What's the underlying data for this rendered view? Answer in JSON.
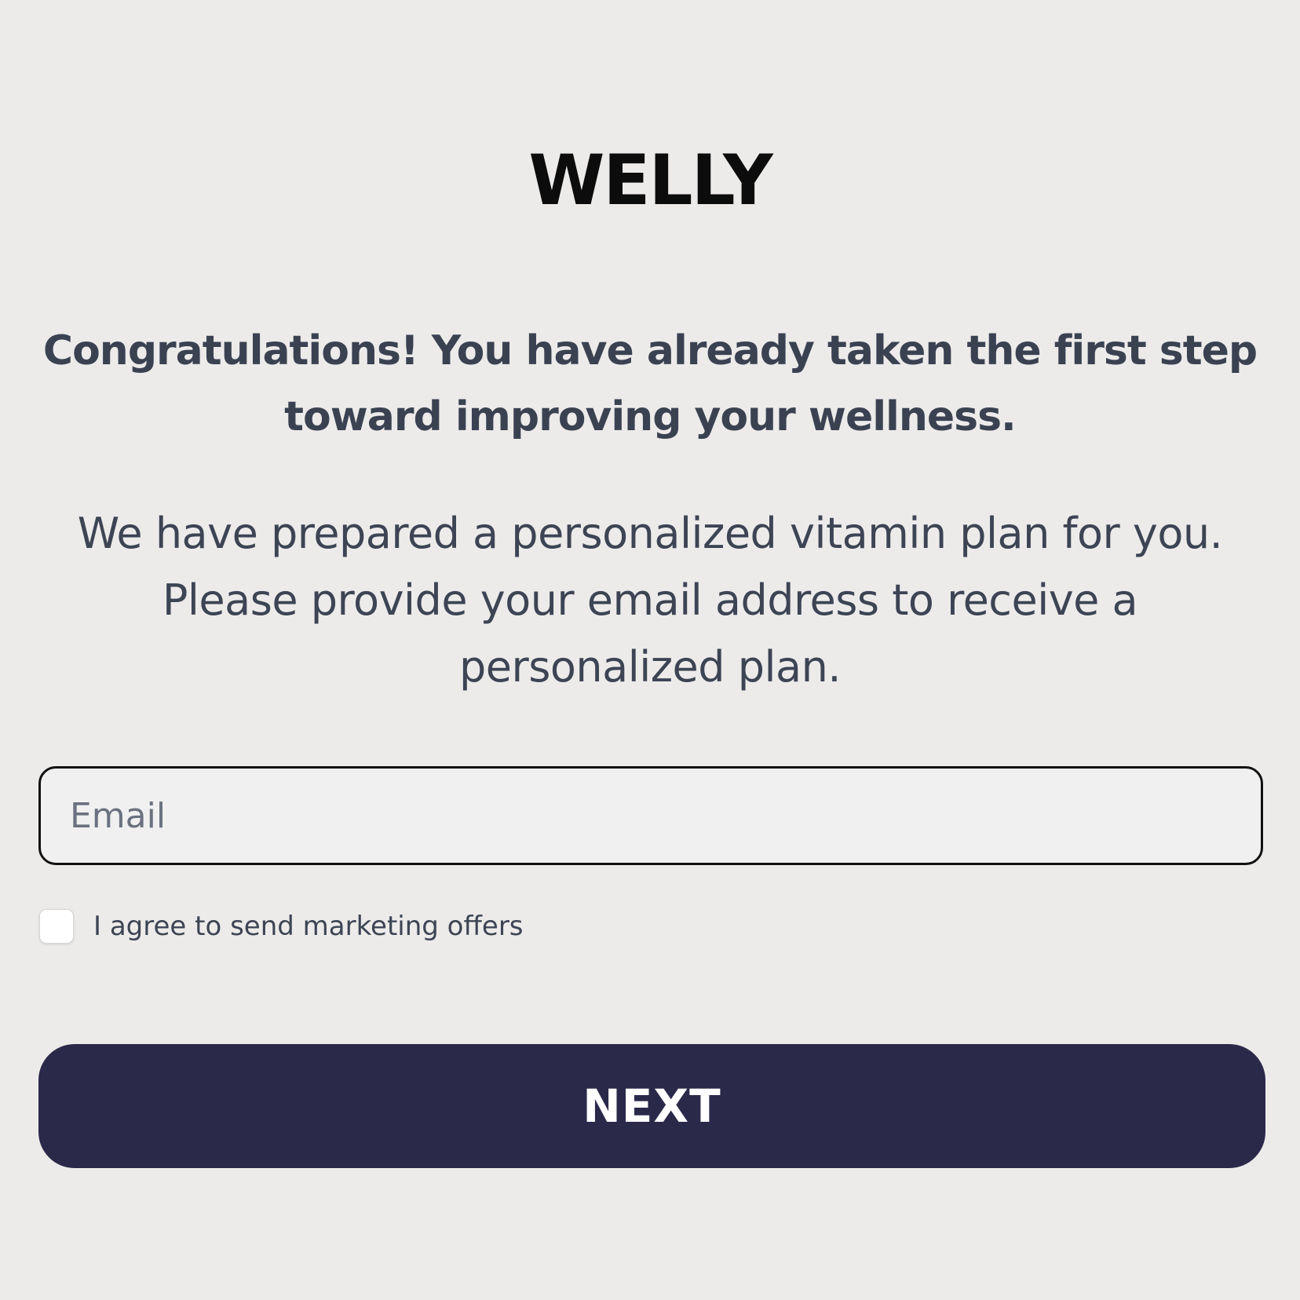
{
  "logo": {
    "text": "WELLY"
  },
  "headline": {
    "text": "Congratulations! You have already taken the first step toward improving your wellness."
  },
  "subtext": {
    "text": "We have prepared a personalized vitamin plan for you. Please provide your email address to receive a personalized plan."
  },
  "email_field": {
    "placeholder": "Email",
    "value": ""
  },
  "consent": {
    "label": "I agree to send marketing offers",
    "checked": false
  },
  "next_button": {
    "label": "NEXT"
  },
  "colors": {
    "background": "#edebea",
    "button": "#2b294a",
    "text": "#3a4252"
  }
}
